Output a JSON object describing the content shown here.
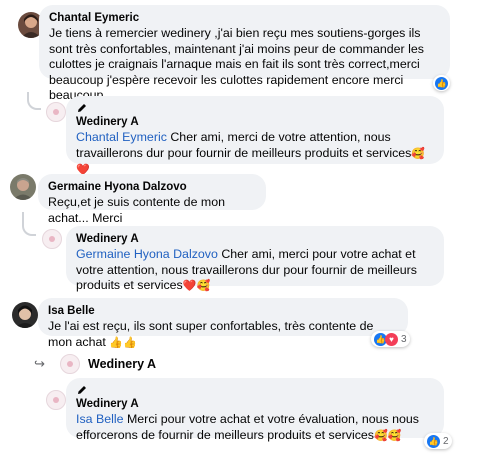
{
  "comments": [
    {
      "author": "Chantal Eymeric",
      "text": "Je tiens à remercier wedinery ,j'ai bien reçu mes soutiens-gorges ils sont très confortables, maintenant j'ai moins peur de commander les culottes je craignais l'arnaque mais en fait ils sont très correct,merci beaucoup j'espère recevoir les culottes rapidement encore merci beaucoup",
      "reaction_icon": "like-icon",
      "reply": {
        "author": "Wedinery A",
        "mention": "Chantal Eymeric",
        "text": " Cher ami, merci de votre attention, nous travaillerons dur pour fournir de meilleurs produits et services",
        "emojis": "🥰❤️"
      }
    },
    {
      "author": "Germaine Hyona Dalzovo",
      "text": "Reçu,et je suis contente de mon achat... Merci",
      "reply": {
        "author": "Wedinery A",
        "mention": "Germaine Hyona Dalzovo",
        "text": " Cher ami, merci pour votre achat et votre attention, nous travaillerons dur pour fournir de meilleurs produits et services",
        "emojis": "❤️🥰"
      }
    },
    {
      "author": "Isa Belle",
      "text": "Je l'ai est reçu, ils sont super confortables, très contente de mon achat",
      "emojis": "👍👍",
      "reaction_count": "3",
      "reply_label": "Wedinery A",
      "reply": {
        "author": "Wedinery A",
        "mention": "Isa Belle",
        "text": " Merci pour votre achat et votre évaluation, nous nous efforcerons de fournir de meilleurs produits et services",
        "emojis": "🥰🥰",
        "reaction_count": "2"
      }
    }
  ],
  "icons": {
    "edited": "pencil-icon",
    "reply_arrow": "reply-arrow-icon",
    "like": "like-icon",
    "love": "love-icon"
  },
  "colors": {
    "bubble": "#f0f2f5",
    "mention": "#2161c1",
    "like": "#1877f2",
    "love": "#f33e58"
  }
}
